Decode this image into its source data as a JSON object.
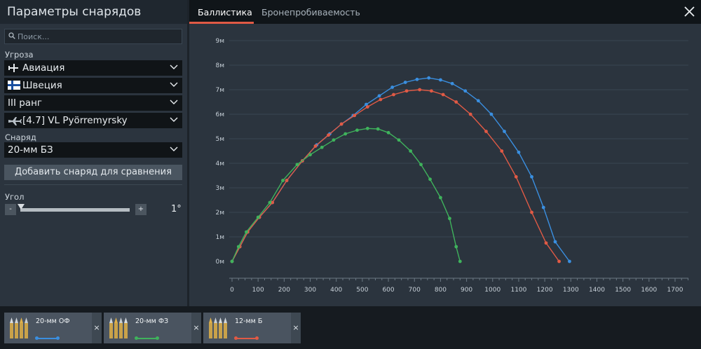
{
  "panel": {
    "title": "Параметры снарядов",
    "search_placeholder": "Поиск...",
    "threat_label": "Угроза",
    "threat_value": "Авиация",
    "country_value": "Швеция",
    "rank_value": "III ранг",
    "vehicle_value": "[4.7] VL Pyörremyrsky",
    "shell_label": "Снаряд",
    "shell_value": "20-мм БЗ",
    "add_button": "Добавить снаряд для сравнения",
    "angle_label": "Угол",
    "angle_value": "1°",
    "minus": "-",
    "plus": "+"
  },
  "tabs": [
    {
      "label": "Баллистика",
      "active": true
    },
    {
      "label": "Бронепробиваемость",
      "active": false
    }
  ],
  "colors": {
    "blue": "#3a8fe0",
    "red": "#e15a45",
    "green": "#3fb35c",
    "accent": "#e15a45"
  },
  "chart_data": {
    "type": "line",
    "xlim": [
      0,
      1700
    ],
    "ylim": [
      0,
      9
    ],
    "x_ticks": [
      "0",
      "100",
      "200",
      "300",
      "400",
      "500",
      "600",
      "700",
      "800",
      "900",
      "1000",
      "1100",
      "1200",
      "1300",
      "1400",
      "1500",
      "1600",
      "1700"
    ],
    "y_ticks": [
      "0м",
      "1м",
      "2м",
      "3м",
      "4м",
      "5м",
      "6м",
      "7м",
      "8м",
      "9м"
    ],
    "grid": true,
    "series": [
      {
        "color": "blue",
        "points": [
          [
            0,
            0
          ],
          [
            30,
            0.6
          ],
          [
            60,
            1.2
          ],
          [
            105,
            1.8
          ],
          [
            155,
            2.4
          ],
          [
            210,
            3.3
          ],
          [
            270,
            4.1
          ],
          [
            325,
            4.75
          ],
          [
            375,
            5.2
          ],
          [
            420,
            5.6
          ],
          [
            465,
            5.95
          ],
          [
            515,
            6.4
          ],
          [
            565,
            6.75
          ],
          [
            615,
            7.1
          ],
          [
            665,
            7.3
          ],
          [
            710,
            7.42
          ],
          [
            755,
            7.48
          ],
          [
            800,
            7.4
          ],
          [
            845,
            7.25
          ],
          [
            895,
            6.95
          ],
          [
            945,
            6.55
          ],
          [
            995,
            6.0
          ],
          [
            1045,
            5.3
          ],
          [
            1100,
            4.45
          ],
          [
            1150,
            3.45
          ],
          [
            1195,
            2.2
          ],
          [
            1240,
            0.8
          ],
          [
            1295,
            0.0
          ]
        ]
      },
      {
        "color": "red",
        "points": [
          [
            0,
            0
          ],
          [
            30,
            0.6
          ],
          [
            60,
            1.2
          ],
          [
            105,
            1.8
          ],
          [
            155,
            2.4
          ],
          [
            210,
            3.3
          ],
          [
            270,
            4.1
          ],
          [
            320,
            4.7
          ],
          [
            370,
            5.15
          ],
          [
            420,
            5.6
          ],
          [
            470,
            5.95
          ],
          [
            520,
            6.3
          ],
          [
            570,
            6.6
          ],
          [
            620,
            6.8
          ],
          [
            670,
            6.95
          ],
          [
            720,
            7.0
          ],
          [
            765,
            6.95
          ],
          [
            810,
            6.8
          ],
          [
            860,
            6.5
          ],
          [
            915,
            6.0
          ],
          [
            975,
            5.3
          ],
          [
            1035,
            4.5
          ],
          [
            1090,
            3.45
          ],
          [
            1150,
            2.0
          ],
          [
            1205,
            0.75
          ],
          [
            1255,
            0.0
          ]
        ]
      },
      {
        "color": "green",
        "points": [
          [
            0,
            0
          ],
          [
            25,
            0.6
          ],
          [
            55,
            1.2
          ],
          [
            100,
            1.8
          ],
          [
            145,
            2.4
          ],
          [
            195,
            3.3
          ],
          [
            250,
            3.95
          ],
          [
            300,
            4.35
          ],
          [
            345,
            4.65
          ],
          [
            390,
            4.95
          ],
          [
            435,
            5.2
          ],
          [
            480,
            5.35
          ],
          [
            520,
            5.42
          ],
          [
            560,
            5.4
          ],
          [
            600,
            5.25
          ],
          [
            640,
            4.95
          ],
          [
            685,
            4.5
          ],
          [
            725,
            3.95
          ],
          [
            760,
            3.35
          ],
          [
            800,
            2.6
          ],
          [
            835,
            1.75
          ],
          [
            860,
            0.6
          ],
          [
            875,
            0.0
          ]
        ]
      }
    ]
  },
  "shell_cards": [
    {
      "label": "20-мм ОФ",
      "color": "blue"
    },
    {
      "label": "20-мм ФЗ",
      "color": "green"
    },
    {
      "label": "12-мм Б",
      "color": "red"
    }
  ],
  "close_glyph": "×"
}
